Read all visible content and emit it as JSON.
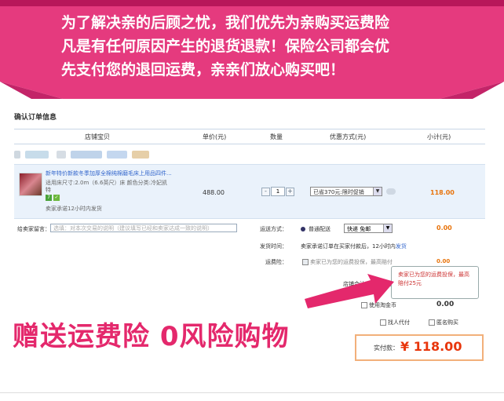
{
  "banner": {
    "lines": [
      "为了解决亲的后顾之忧，我们优先为亲购买运费险",
      "凡是有任何原因产生的退货退款！保险公司都会优",
      "先支付您的退回运费，亲亲们放心购买吧！"
    ],
    "bg_color": "#e53a7e"
  },
  "order": {
    "section_title": "确认订单信息",
    "headers": [
      "店铺宝贝",
      "单价(元)",
      "数量",
      "优惠方式(元)",
      "小计(元)"
    ],
    "item": {
      "title": "新年特价新款冬季加厚全棉纯棉磨毛床上用品四件...",
      "spec": "适用床尺寸:2.0m（6.6英尺）床  颜色分类:冷妃凯",
      "spec2": "特",
      "badge1": "7",
      "badge2": "✓",
      "note": "卖家承诺12小时内发货",
      "price": "488.00",
      "qty_minus": "-",
      "qty": "1",
      "qty_plus": "+",
      "promo": "已省370元:限时促销",
      "subtotal": "118.00"
    },
    "message_label": "给卖家留言：",
    "message_placeholder": "选填：对本次交易的说明（建议填写已经和卖家达成一致的说明）",
    "shipping_label": "运送方式：",
    "shipping_normal": "普通配送",
    "shipping_option": "快递 免邮",
    "shipping_fee": "0.00",
    "ship_time_label": "发货时间：",
    "ship_time_text": "卖家承诺订单在买家付款后，12小时内",
    "ship_time_link": "发货",
    "insurance_label": "运费险：",
    "insurance_text": "卖家已为您的运费投保，最高赔付",
    "insurance_fee": "0.00",
    "tooltip": "卖家已为您的运费投保，最高赔付25元",
    "shop_total_label": "店铺合计(含运费，服",
    "taobao_label": "使用淘金币",
    "taobao_value": "0.00",
    "agent_label": "找人代付",
    "anon_label": "匿名购买",
    "pay_label": "实付款：",
    "pay_amount": "¥ 118.00"
  },
  "promo_headline": "赠送运费险  0风险购物",
  "colors": {
    "pink": "#e53a7e",
    "headline": "#e4286c",
    "orange": "#e8740c",
    "link": "#3366cc"
  }
}
